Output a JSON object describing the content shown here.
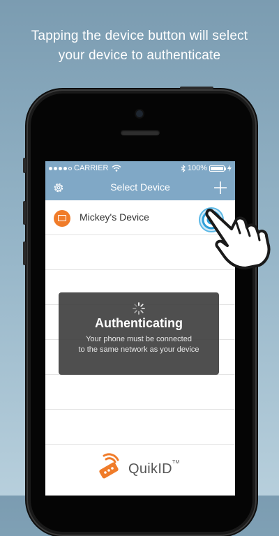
{
  "caption": {
    "line1": "Tapping the device button will select",
    "line2": "your device to authenticate"
  },
  "statusbar": {
    "carrier": "CARRIER",
    "wifi_icon": "wifi-icon",
    "bluetooth_icon": "bluetooth-icon",
    "battery_text": "100%",
    "battery_level": 1.0,
    "signal_bars": 5,
    "signal_filled": 4
  },
  "navbar": {
    "title": "Select Device",
    "settings_icon": "gear-icon",
    "add_icon": "plus-icon"
  },
  "devices": [
    {
      "name": "Mickey's Device",
      "icon": "tv-icon"
    }
  ],
  "modal": {
    "title": "Authenticating",
    "message_line1": "Your phone must be connected",
    "message_line2": "to the same network as your device"
  },
  "brand": {
    "name": "QuikID",
    "tm": "TM"
  },
  "colors": {
    "accent": "#80a8c6",
    "device_icon": "#f07c2a",
    "select_ring": "#2f9fd8",
    "logo_orange": "#f07c2a"
  }
}
